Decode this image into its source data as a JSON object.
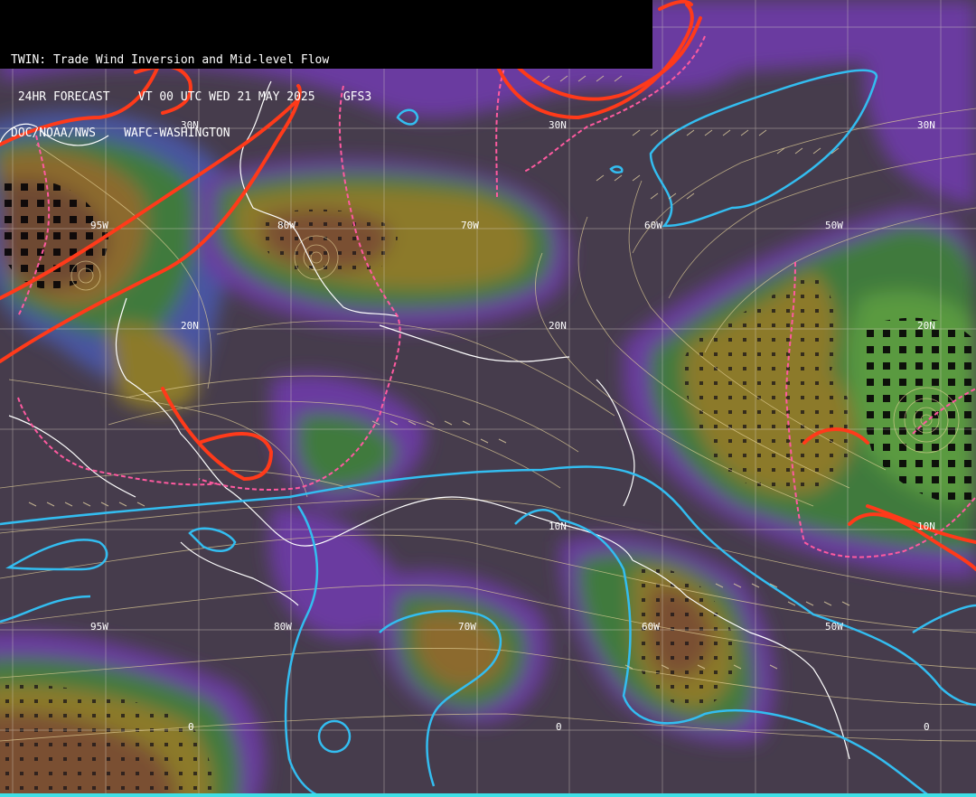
{
  "header": {
    "line1": "TWIN: Trade Wind Inversion and Mid-level Flow",
    "line2": " 24HR FORECAST    VT 00 UTC WED 21 MAY 2025    GFS3",
    "line3": "DOC/NOAA/NWS    WAFC-WASHINGTON"
  },
  "labels": {
    "lat30w": "30N",
    "lat30e": "30N",
    "lat20a": "20N",
    "lat20b": "20N",
    "lat20c": "20N",
    "lat10a": "10N",
    "lat10b": "10N",
    "lon95a": "95W",
    "lon80a": "80W",
    "lon70a": "70W",
    "lon60a": "60W",
    "lon50a": "50W",
    "lon95b": "95W",
    "lon80b": "80W",
    "lon70b": "70W",
    "lon60b": "60W",
    "lon50b": "50W",
    "eq1": "0",
    "eq2": "0",
    "eq3": "0"
  },
  "colors": {
    "background": "#463c4c",
    "purple": "#7a3aa6",
    "blue": "#4a54a0",
    "green": "#3f7a3c",
    "lightgreen": "#5a9a40",
    "olive": "#8c7a2a",
    "brown": "#7a5030",
    "inversion_line": "#ff3a1a",
    "dashed_line": "#ff5aa0",
    "cyan_line": "#33bdf0",
    "streamline": "#e8d59a"
  }
}
